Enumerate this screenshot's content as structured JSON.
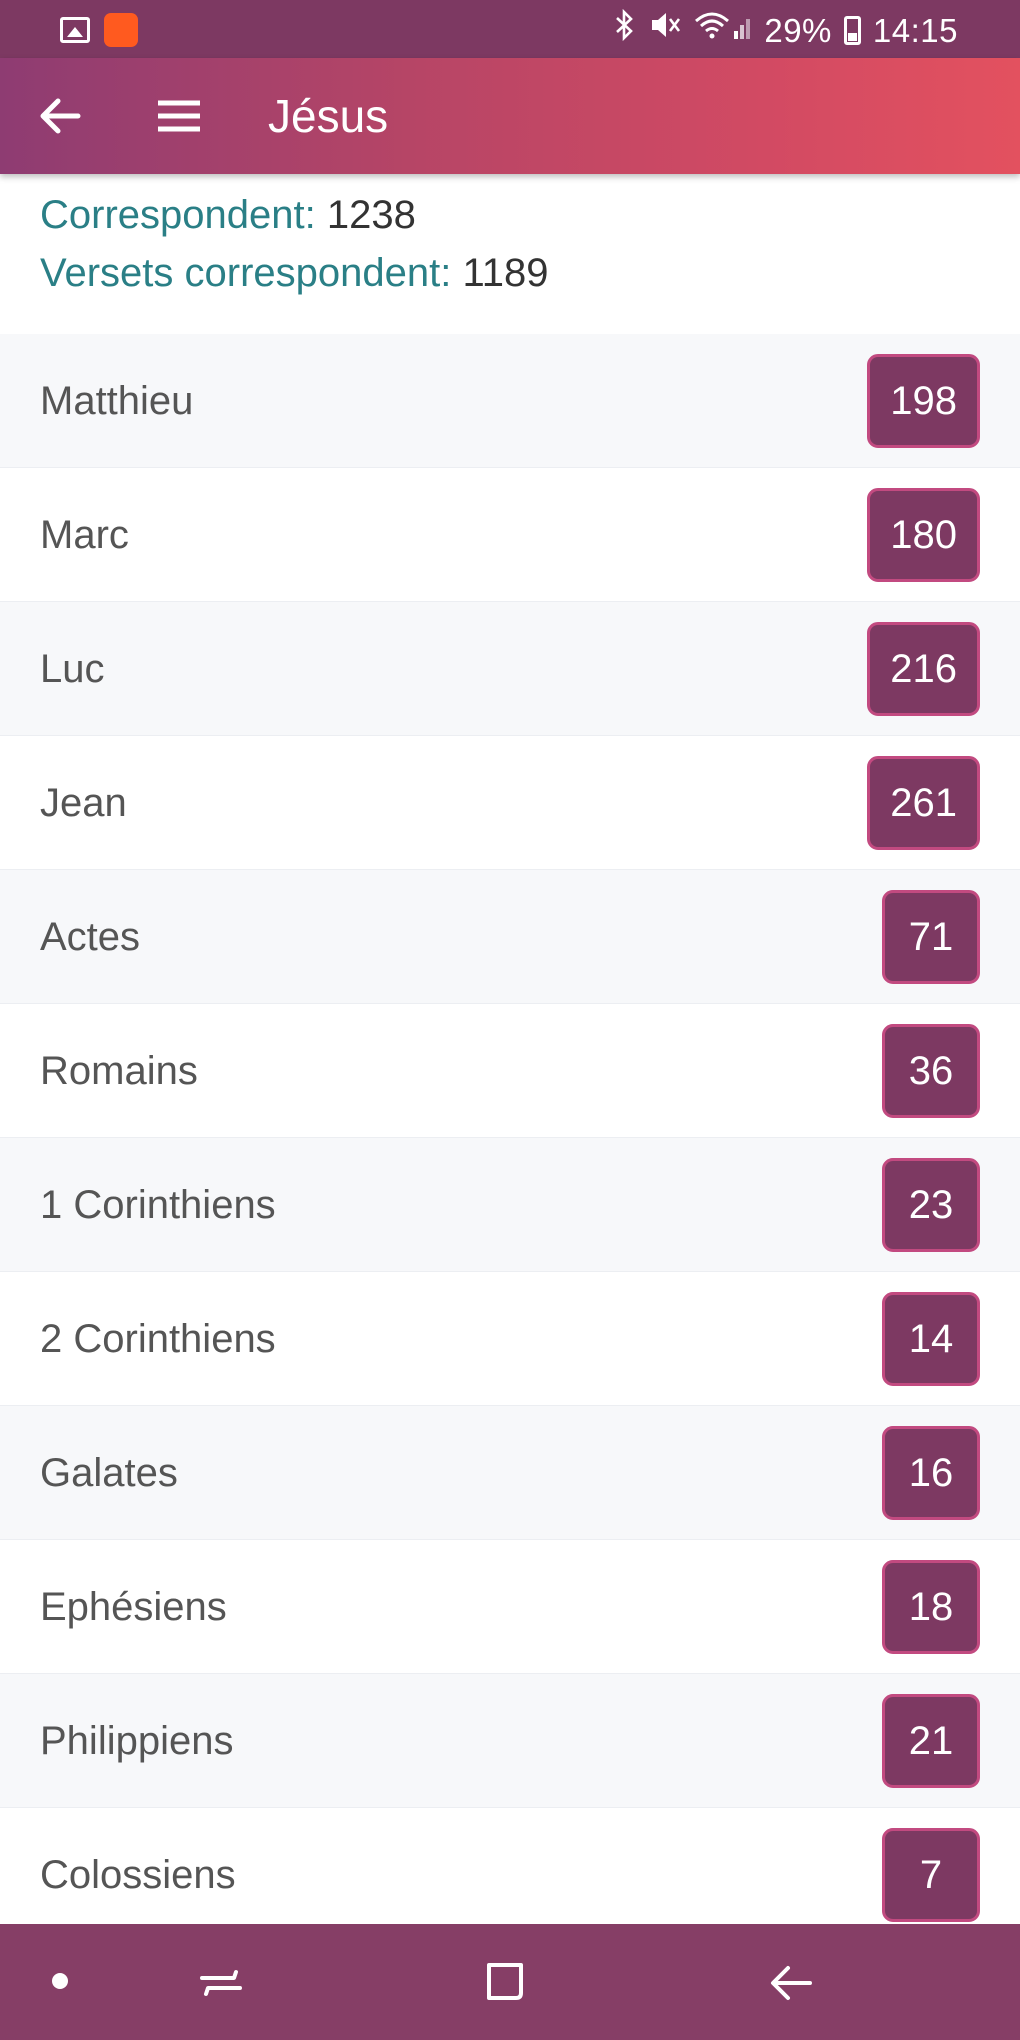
{
  "status_bar": {
    "battery": "29%",
    "time": "14:15"
  },
  "app_bar": {
    "title": "Jésus",
    "back_icon": "arrow-left-icon",
    "menu_icon": "hamburger-menu-icon"
  },
  "summary": {
    "matches_label": "Correspondent:",
    "matches_value": "1238",
    "verses_label": "Versets correspondent:",
    "verses_value": "1189"
  },
  "books": [
    {
      "name": "Matthieu",
      "count": "198"
    },
    {
      "name": "Marc",
      "count": "180"
    },
    {
      "name": "Luc",
      "count": "216"
    },
    {
      "name": "Jean",
      "count": "261"
    },
    {
      "name": "Actes",
      "count": "71"
    },
    {
      "name": "Romains",
      "count": "36"
    },
    {
      "name": "1 Corinthiens",
      "count": "23"
    },
    {
      "name": "2 Corinthiens",
      "count": "14"
    },
    {
      "name": "Galates",
      "count": "16"
    },
    {
      "name": "Ephésiens",
      "count": "18"
    },
    {
      "name": "Philippiens",
      "count": "21"
    },
    {
      "name": "Colossiens",
      "count": "7"
    }
  ],
  "colors": {
    "badge": "#7d3962",
    "accent_label": "#2a7f86",
    "navbar": "#863e66"
  }
}
